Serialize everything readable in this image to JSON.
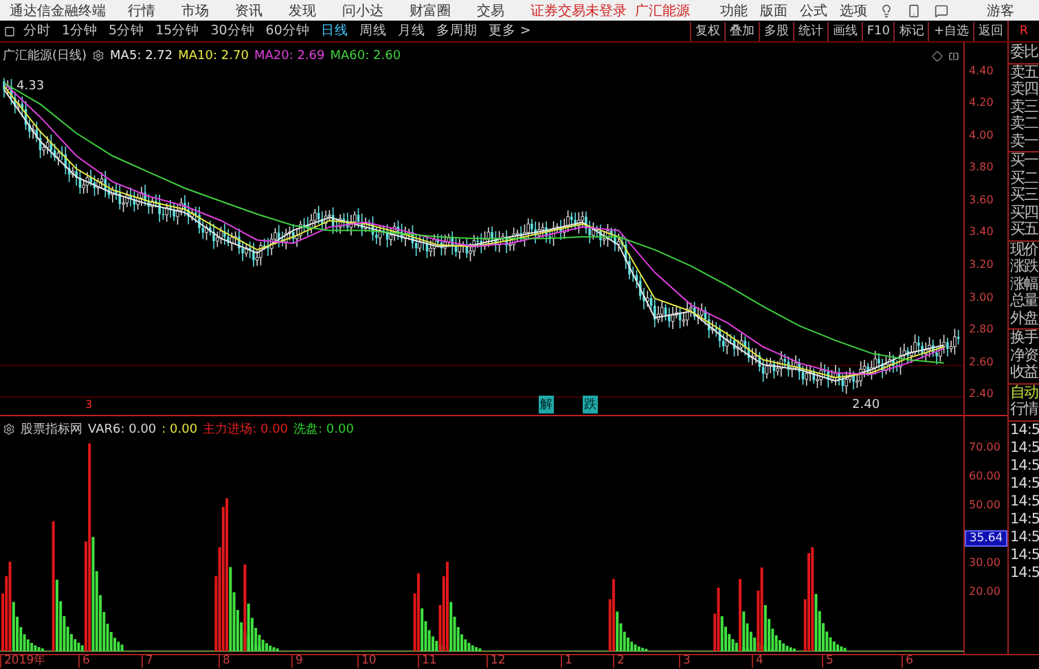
{
  "menu_bar": {
    "app_title": "通达信金融终端",
    "menus": [
      "行情",
      "市场",
      "资讯",
      "发现",
      "问小达",
      "财富圈",
      "交易"
    ],
    "login_status": "证券交易未登录",
    "stock_name": "广汇能源",
    "right_menus": [
      "功能",
      "版面",
      "公式",
      "选项"
    ],
    "user": "游客"
  },
  "period_tabs": [
    {
      "label": "分时",
      "selected": false
    },
    {
      "label": "1分钟",
      "selected": false
    },
    {
      "label": "5分钟",
      "selected": false
    },
    {
      "label": "15分钟",
      "selected": false
    },
    {
      "label": "30分钟",
      "selected": false
    },
    {
      "label": "60分钟",
      "selected": false
    },
    {
      "label": "日线",
      "selected": true
    },
    {
      "label": "周线",
      "selected": false
    },
    {
      "label": "月线",
      "selected": false
    },
    {
      "label": "多周期",
      "selected": false
    },
    {
      "label": "更多 >",
      "selected": false
    }
  ],
  "tool_buttons": [
    "复权",
    "叠加",
    "多股",
    "统计",
    "画线",
    "F10",
    "标记",
    "+自选",
    "返回"
  ],
  "panel_tab": "R",
  "price_chart": {
    "title": "广汇能源(日线)",
    "ma_readings": [
      ": 2.72",
      ": 2.70",
      ": 2.69",
      ": 2.60"
    ],
    "chart_data": {
      "type": "line",
      "ylim": [
        2.28,
        4.58
      ],
      "series": [
        {
          "name": "MA5",
          "color": "#e8e8e8",
          "values": [
            4.29,
            3.97,
            3.75,
            3.65,
            3.58,
            3.53,
            3.37,
            3.28,
            3.42,
            3.5,
            3.44,
            3.38,
            3.32,
            3.33,
            3.38,
            3.42,
            3.47,
            3.33,
            2.88,
            2.92,
            2.74,
            2.59,
            2.56,
            2.49,
            2.56,
            2.66,
            2.71
          ]
        },
        {
          "name": "MA10",
          "color": "#e8e840",
          "values": [
            4.31,
            4.03,
            3.8,
            3.67,
            3.6,
            3.55,
            3.42,
            3.3,
            3.38,
            3.48,
            3.46,
            3.4,
            3.33,
            3.32,
            3.36,
            3.41,
            3.46,
            3.38,
            3.0,
            2.92,
            2.78,
            2.62,
            2.57,
            2.51,
            2.54,
            2.63,
            2.7
          ]
        },
        {
          "name": "MA20",
          "color": "#e040e0",
          "values": [
            4.33,
            4.12,
            3.88,
            3.72,
            3.63,
            3.57,
            3.48,
            3.36,
            3.34,
            3.44,
            3.47,
            3.42,
            3.36,
            3.32,
            3.34,
            3.39,
            3.44,
            3.42,
            3.16,
            2.96,
            2.85,
            2.7,
            2.6,
            2.54,
            2.53,
            2.6,
            2.69
          ]
        },
        {
          "name": "MA60",
          "color": "#40d040",
          "values": [
            4.33,
            4.2,
            4.02,
            3.88,
            3.78,
            3.68,
            3.6,
            3.52,
            3.45,
            3.42,
            3.42,
            3.4,
            3.38,
            3.37,
            3.37,
            3.37,
            3.38,
            3.38,
            3.3,
            3.2,
            3.08,
            2.95,
            2.83,
            2.74,
            2.66,
            2.62,
            2.6
          ]
        }
      ],
      "yticks": [
        {
          "value": 4.4,
          "label": "4.40"
        },
        {
          "value": 4.2,
          "label": "4.20"
        },
        {
          "value": 4.0,
          "label": "4.00"
        },
        {
          "value": 3.8,
          "label": "3.80"
        },
        {
          "value": 3.6,
          "label": "3.60"
        },
        {
          "value": 3.4,
          "label": "3.40"
        },
        {
          "value": 3.2,
          "label": "3.20"
        },
        {
          "value": 3.0,
          "label": "3.00"
        },
        {
          "value": 2.8,
          "label": "2.80"
        },
        {
          "value": 2.6,
          "label": "2.60"
        },
        {
          "value": 2.4,
          "label": "2.40"
        }
      ]
    },
    "high_label": "4.33",
    "low_label": "2.40",
    "signals": [
      "解",
      "跌"
    ],
    "event_mark": "3"
  },
  "indicator": {
    "title": "股票指标网",
    "values": [
      {
        "label": "VAR6: 0.00",
        "color": "#d8d8d8"
      },
      {
        "label": ": 0.00",
        "color": "#e8e840"
      },
      {
        "label": "主力进场: 0.00",
        "color": "#e02020"
      },
      {
        "label": "洗盘: 0.00",
        "color": "#30d030"
      }
    ],
    "y_ticks": [
      "70.00",
      "60.00",
      "50.00",
      "30.00",
      "20.00"
    ],
    "cursor_value": "35.64"
  },
  "date_axis": [
    "2019年",
    "6",
    "7",
    "8",
    "9",
    "10",
    "11",
    "12",
    "1",
    "2",
    "3",
    "4",
    "5",
    "6"
  ],
  "quote_panel": {
    "groups": [
      [
        "委比"
      ],
      [
        "卖五",
        "卖四",
        "卖三",
        "卖二",
        "卖一"
      ],
      [
        "买一",
        "买二",
        "买三",
        "买四",
        "买五"
      ],
      [
        "现价",
        "涨跌",
        "涨幅",
        "总量",
        "外盘"
      ],
      [
        "换手",
        "净资",
        "收益"
      ]
    ],
    "mode": "自动",
    "ticks_title": "行情",
    "times": [
      "14:5",
      "14:5",
      "14:5",
      "14:5",
      "14:5",
      "14:5",
      "14:5",
      "14:5",
      "14:5"
    ]
  }
}
